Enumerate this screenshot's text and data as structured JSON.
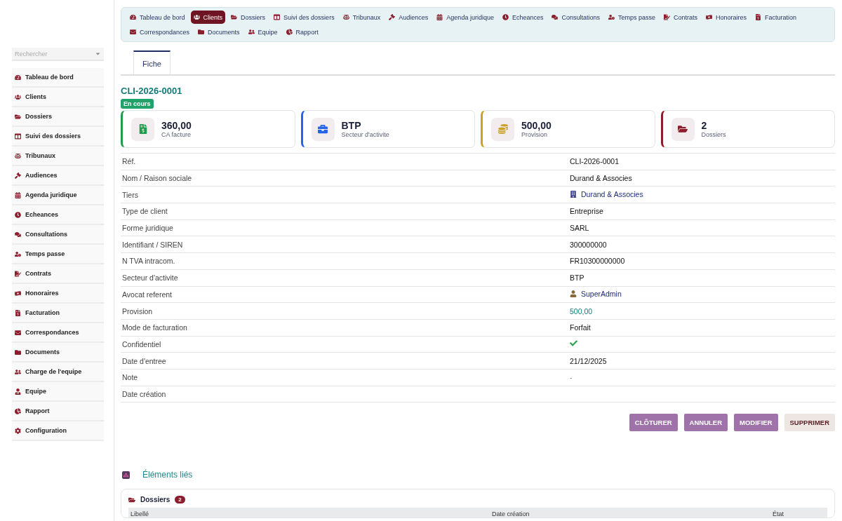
{
  "sidebar": {
    "search": {
      "placeholder": "Rechercher"
    },
    "items": [
      {
        "label": "Tableau de bord"
      },
      {
        "label": "Clients"
      },
      {
        "label": "Dossiers"
      },
      {
        "label": "Suivi des dossiers"
      },
      {
        "label": "Tribunaux"
      },
      {
        "label": "Audiences"
      },
      {
        "label": "Agenda juridique"
      },
      {
        "label": "Echeances"
      },
      {
        "label": "Consultations"
      },
      {
        "label": "Temps passe"
      },
      {
        "label": "Contrats"
      },
      {
        "label": "Honoraires"
      },
      {
        "label": "Facturation"
      },
      {
        "label": "Correspondances"
      },
      {
        "label": "Documents"
      },
      {
        "label": "Charge de l'equipe"
      },
      {
        "label": "Equipe"
      },
      {
        "label": "Rapport"
      },
      {
        "label": "Configuration"
      }
    ]
  },
  "top_nav": [
    {
      "label": "Tableau de bord",
      "selected": false
    },
    {
      "label": "Clients",
      "selected": true
    },
    {
      "label": "Dossiers",
      "selected": false
    },
    {
      "label": "Suivi des dossiers",
      "selected": false
    },
    {
      "label": "Tribunaux",
      "selected": false
    },
    {
      "label": "Audiences",
      "selected": false
    },
    {
      "label": "Agenda juridique",
      "selected": false
    },
    {
      "label": "Echeances",
      "selected": false
    },
    {
      "label": "Consultations",
      "selected": false
    },
    {
      "label": "Temps passe",
      "selected": false
    },
    {
      "label": "Contrats",
      "selected": false
    },
    {
      "label": "Honoraires",
      "selected": false
    },
    {
      "label": "Facturation",
      "selected": false
    },
    {
      "label": "Correspondances",
      "selected": false
    },
    {
      "label": "Documents",
      "selected": false
    },
    {
      "label": "Equipe",
      "selected": false
    },
    {
      "label": "Rapport",
      "selected": false
    }
  ],
  "tabs": [
    {
      "label": "Fiche",
      "selected": true
    }
  ],
  "record": {
    "ref": "CLI-2026-0001",
    "status": "En cours"
  },
  "stats": [
    {
      "value": "360,00",
      "label": "CA facture",
      "color": "#1f9d4c"
    },
    {
      "value": "BTP",
      "label": "Secteur d'activite",
      "color": "#2563eb"
    },
    {
      "value": "500,00",
      "label": "Provision",
      "color": "#c9a227"
    },
    {
      "value": "2",
      "label": "Dossiers",
      "color": "#8b1d2c"
    }
  ],
  "fields": [
    {
      "label": "Réf.",
      "kind": "text",
      "value": "CLI-2026-0001"
    },
    {
      "label": "Nom / Raison sociale",
      "kind": "text",
      "value": "Durand & Associes"
    },
    {
      "label": "Tiers",
      "kind": "company-link",
      "value": "Durand & Associes"
    },
    {
      "label": "Type de client",
      "kind": "text",
      "value": "Entreprise"
    },
    {
      "label": "Forme juridique",
      "kind": "text",
      "value": "SARL"
    },
    {
      "label": "Identifiant / SIREN",
      "kind": "text",
      "value": "300000000"
    },
    {
      "label": "N TVA intracom.",
      "kind": "text",
      "value": "FR10300000000"
    },
    {
      "label": "Secteur d'activite",
      "kind": "text",
      "value": "BTP"
    },
    {
      "label": "Avocat referent",
      "kind": "user-link",
      "value": "SuperAdmin"
    },
    {
      "label": "Provision",
      "kind": "money",
      "value": "500,00"
    },
    {
      "label": "Mode de facturation",
      "kind": "text",
      "value": "Forfait"
    },
    {
      "label": "Confidentiel",
      "kind": "check",
      "checked": true
    },
    {
      "label": "Date d'entree",
      "kind": "text",
      "value": "21/12/2025"
    },
    {
      "label": "Note",
      "kind": "muted",
      "value": "-"
    },
    {
      "label": "Date création",
      "kind": "empty"
    }
  ],
  "actions": [
    {
      "label": "CLÔTURER",
      "kind": "primary"
    },
    {
      "label": "ANNULER",
      "kind": "primary"
    },
    {
      "label": "MODIFIER",
      "kind": "primary"
    },
    {
      "label": "SUPPRIMER",
      "kind": "danger"
    }
  ],
  "related": {
    "title": "Éléments liés",
    "section": {
      "title": "Dossiers",
      "count": "2",
      "columns": [
        "Libellé",
        "Date création",
        "État"
      ]
    }
  }
}
